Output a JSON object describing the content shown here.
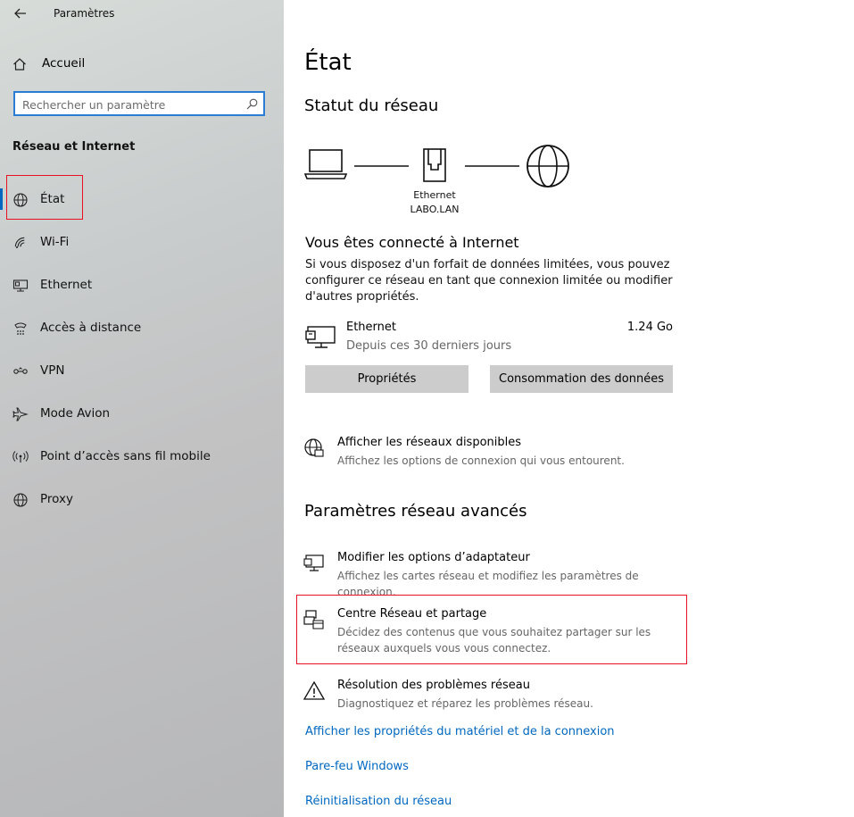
{
  "app_title": "Paramètres",
  "home_label": "Accueil",
  "search": {
    "placeholder": "Rechercher un paramètre"
  },
  "section_heading": "Réseau et Internet",
  "nav": {
    "etat": "État",
    "wifi": "Wi-Fi",
    "ethernet": "Ethernet",
    "acces_distance": "Accès à distance",
    "vpn": "VPN",
    "mode_avion": "Mode Avion",
    "point_acces": "Point d’accès sans fil mobile",
    "proxy": "Proxy"
  },
  "main": {
    "title": "État",
    "status_heading": "Statut du réseau",
    "diagram": {
      "adapter_name": "Ethernet",
      "network_name": "LABO.LAN"
    },
    "connected_title": "Vous êtes connecté à Internet",
    "connected_desc": "Si vous disposez d'un forfait de données limitées, vous pouvez configurer ce réseau en tant que connexion limitée ou modifier d'autres propriétés.",
    "ethernet_name": "Ethernet",
    "ethernet_period": "Depuis ces 30 derniers jours",
    "ethernet_usage": "1.24 Go",
    "btn_properties": "Propriétés",
    "btn_data_usage": "Consommation des données",
    "show_networks_title": "Afficher les réseaux disponibles",
    "show_networks_desc": "Affichez les options de connexion qui vous entourent.",
    "advanced_heading": "Paramètres réseau avancés",
    "adapter_title": "Modifier les options d’adaptateur",
    "adapter_desc": "Affichez les cartes réseau et modifiez les paramètres de connexion.",
    "sharing_title": "Centre Réseau et partage",
    "sharing_desc": "Décidez des contenus que vous souhaitez partager sur les réseaux auxquels vous vous connectez.",
    "troubleshoot_title": "Résolution des problèmes réseau",
    "troubleshoot_desc": "Diagnostiquez et réparez les problèmes réseau.",
    "link_hw_props": "Afficher les propriétés du matériel et de la connexion",
    "link_firewall": "Pare-feu Windows",
    "link_reset": "Réinitialisation du réseau"
  },
  "colors": {
    "accent": "#0067c0",
    "highlight": "#e81123",
    "button": "#cccccc"
  }
}
